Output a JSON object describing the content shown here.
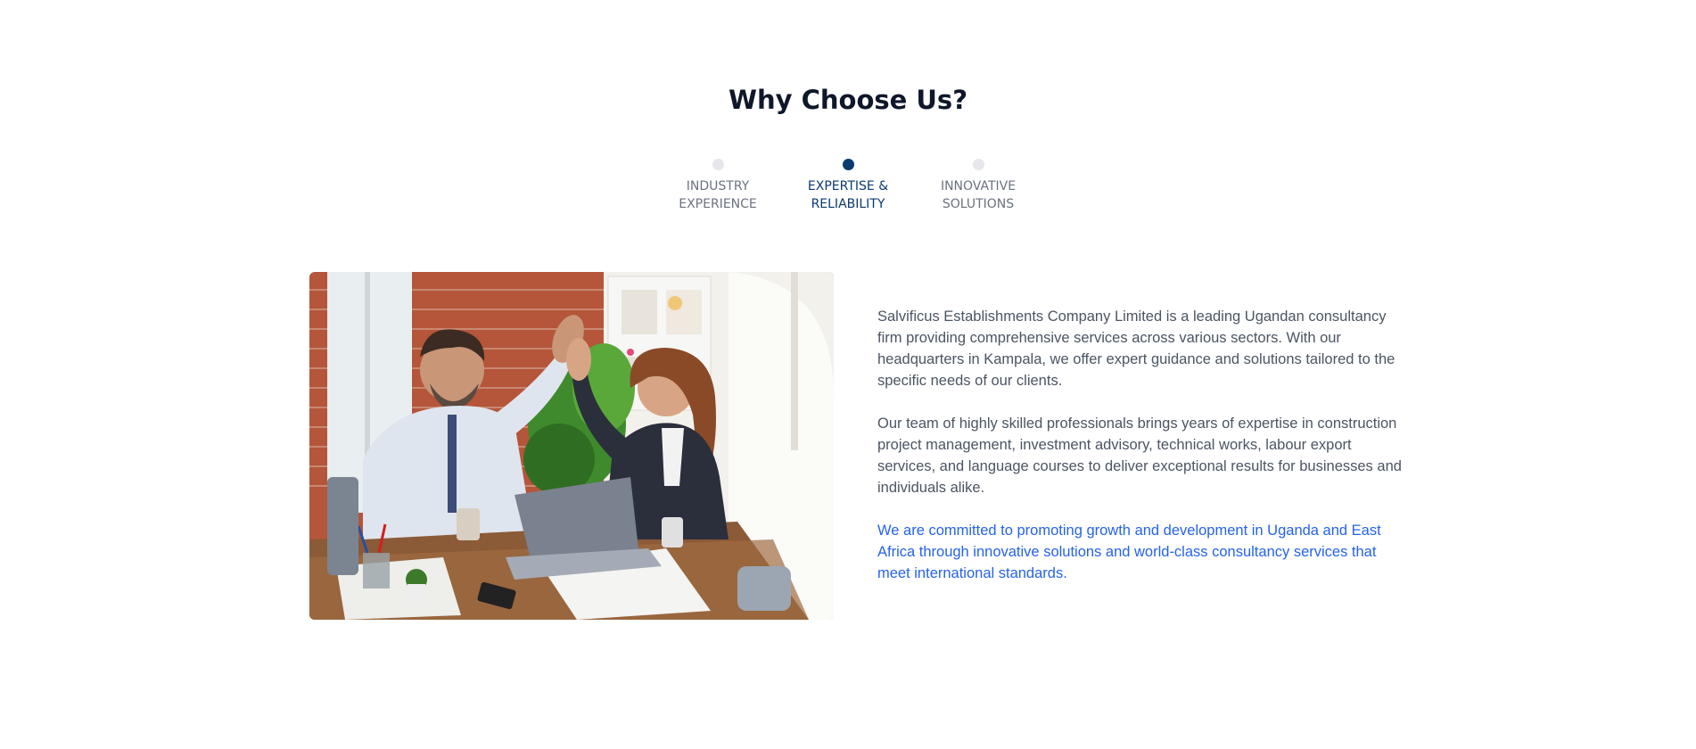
{
  "section": {
    "title": "Why Choose Us?"
  },
  "tabs": [
    {
      "label": "INDUSTRY\nEXPERIENCE",
      "active": false
    },
    {
      "label": "EXPERTISE &\nRELIABILITY",
      "active": true
    },
    {
      "label": "INNOVATIVE\nSOLUTIONS",
      "active": false
    }
  ],
  "content": {
    "paragraph1": "Salvificus Establishments Company Limited is a leading Ugandan consultancy firm providing comprehensive services across various sectors. With our headquarters in Kampala, we offer expert guidance and solutions tailored to the specific needs of our clients.",
    "paragraph2": "Our team of highly skilled professionals brings years of expertise in construction project management, investment advisory, technical works, labour export services, and language courses to deliver exceptional results for businesses and individuals alike.",
    "highlight": "We are committed to promoting growth and development in Uganda and East Africa through innovative solutions and world-class consultancy services that meet international standards."
  },
  "colors": {
    "active_tab": "#0b3a70",
    "inactive_dot": "#e5e7eb",
    "highlight_text": "#2563eb",
    "body_text": "#4b5563",
    "heading": "#0f172a"
  }
}
